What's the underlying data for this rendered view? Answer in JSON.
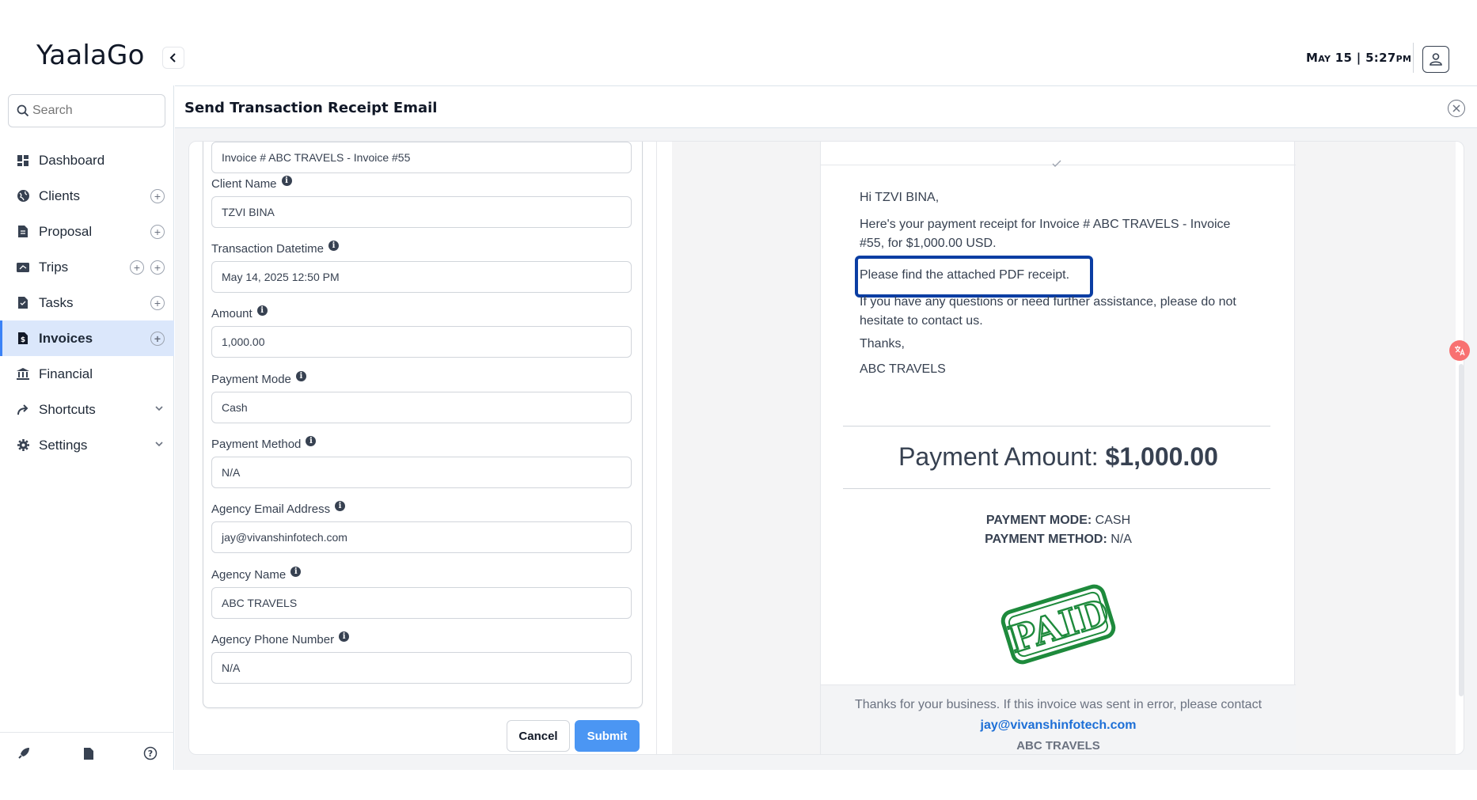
{
  "app": {
    "logo": "YaalaGo"
  },
  "header": {
    "clock": "May 15 | 5:27pm"
  },
  "search": {
    "placeholder": "Search"
  },
  "sidebar": {
    "items": [
      {
        "label": "Dashboard",
        "icon": "dashboard-icon"
      },
      {
        "label": "Clients",
        "icon": "globe-icon",
        "plus": 1
      },
      {
        "label": "Proposal",
        "icon": "document-icon",
        "plus": 1
      },
      {
        "label": "Trips",
        "icon": "ticket-icon",
        "plus": 2
      },
      {
        "label": "Tasks",
        "icon": "clipboard-icon",
        "plus": 1
      },
      {
        "label": "Invoices",
        "icon": "invoice-icon",
        "plus": 1,
        "active": true
      },
      {
        "label": "Financial",
        "icon": "bank-icon"
      },
      {
        "label": "Shortcuts",
        "icon": "share-icon",
        "expandable": true
      },
      {
        "label": "Settings",
        "icon": "gear-icon",
        "expandable": true
      }
    ]
  },
  "modal": {
    "title": "Send Transaction Receipt Email",
    "fields": [
      {
        "label": "",
        "value": "Invoice # ABC TRAVELS - Invoice #55"
      },
      {
        "label": "Client Name",
        "value": "TZVI BINA"
      },
      {
        "label": "Transaction Datetime",
        "value": "May 14, 2025 12:50 PM"
      },
      {
        "label": "Amount",
        "value": "1,000.00"
      },
      {
        "label": "Payment Mode",
        "value": "Cash"
      },
      {
        "label": "Payment Method",
        "value": "N/A"
      },
      {
        "label": "Agency Email Address",
        "value": "jay@vivanshinfotech.com"
      },
      {
        "label": "Agency Name",
        "value": "ABC TRAVELS"
      },
      {
        "label": "Agency Phone Number",
        "value": "N/A"
      }
    ],
    "cancel_label": "Cancel",
    "submit_label": "Submit"
  },
  "email": {
    "greeting": "Hi TZVI BINA,",
    "paragraph1": "Here's your payment receipt for Invoice # ABC TRAVELS - Invoice #55, for $1,000.00 USD.",
    "paragraph2": "Please find the attached PDF receipt.",
    "paragraph3": "If you have any questions or need further assistance, please do not hesitate to contact us.",
    "thanks": "Thanks,",
    "signature": "ABC TRAVELS",
    "payment_amount_label": "Payment Amount:",
    "payment_amount_value": "$1,000.00",
    "payment_mode_label": "PAYMENT MODE:",
    "payment_mode_value": "CASH",
    "payment_method_label": "PAYMENT METHOD:",
    "payment_method_value": "N/A",
    "stamp_text": "PAID",
    "footer_text": "Thanks for your business. If this invoice was sent in error, please contact",
    "footer_email": "jay@vivanshinfotech.com",
    "footer_brand": "ABC TRAVELS"
  },
  "colors": {
    "accent": "#4b96f3",
    "highlight_border": "#0b3ea3",
    "stamp_green": "#1e8a3c",
    "active_nav_bg": "#dbe7fb"
  }
}
